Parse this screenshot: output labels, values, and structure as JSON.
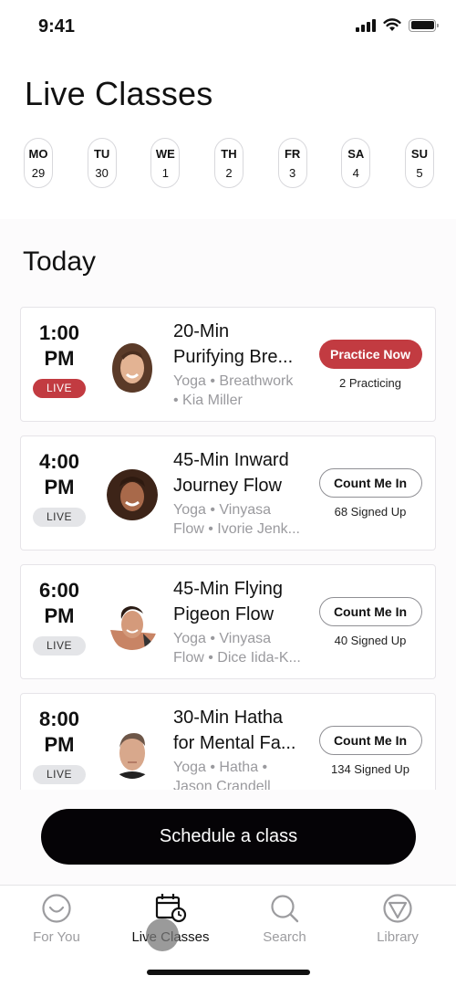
{
  "status_bar": {
    "time": "9:41",
    "signal_icon": "cellular-signal-icon",
    "wifi_icon": "wifi-icon",
    "battery_icon": "battery-icon"
  },
  "header": {
    "title": "Live Classes"
  },
  "days": [
    {
      "name": "MO",
      "num": "29"
    },
    {
      "name": "TU",
      "num": "30"
    },
    {
      "name": "WE",
      "num": "1"
    },
    {
      "name": "TH",
      "num": "2"
    },
    {
      "name": "FR",
      "num": "3"
    },
    {
      "name": "SA",
      "num": "4"
    },
    {
      "name": "SU",
      "num": "5"
    }
  ],
  "section": {
    "title": "Today"
  },
  "classes": [
    {
      "time": "1:00",
      "ampm": "PM",
      "badge": "LIVE",
      "badge_active": true,
      "title_line1": "20-Min",
      "title_line2": "Purifying Bre...",
      "meta_line1": "Yoga • Breathwork",
      "meta_line2": "• Kia Miller",
      "action": "Practice Now",
      "count": "2 Practicing"
    },
    {
      "time": "4:00",
      "ampm": "PM",
      "badge": "LIVE",
      "badge_active": false,
      "title_line1": "45-Min Inward",
      "title_line2": "Journey Flow",
      "meta_line1": "Yoga • Vinyasa",
      "meta_line2": "Flow • Ivorie Jenk...",
      "action": "Count Me In",
      "count": "68 Signed Up"
    },
    {
      "time": "6:00",
      "ampm": "PM",
      "badge": "LIVE",
      "badge_active": false,
      "title_line1": "45-Min Flying",
      "title_line2": "Pigeon Flow",
      "meta_line1": "Yoga • Vinyasa",
      "meta_line2": "Flow • Dice Iida-K...",
      "action": "Count Me In",
      "count": "40 Signed Up"
    },
    {
      "time": "8:00",
      "ampm": "PM",
      "badge": "LIVE",
      "badge_active": false,
      "title_line1": "30-Min Hatha",
      "title_line2": "for Mental Fa...",
      "meta_line1": "Yoga • Hatha •",
      "meta_line2": "Jason Crandell",
      "action": "Count Me In",
      "count": "134 Signed Up"
    }
  ],
  "cta": {
    "label": "Schedule a class"
  },
  "tabs": [
    {
      "label": "For You",
      "icon": "smile-icon",
      "active": false
    },
    {
      "label": "Live Classes",
      "icon": "calendar-clock-icon",
      "active": true
    },
    {
      "label": "Search",
      "icon": "search-icon",
      "active": false
    },
    {
      "label": "Library",
      "icon": "library-triangle-icon",
      "active": false
    }
  ],
  "colors": {
    "accent_red": "#c23b41",
    "cta_black": "#050306",
    "inactive_gray": "#9c9c9f"
  }
}
